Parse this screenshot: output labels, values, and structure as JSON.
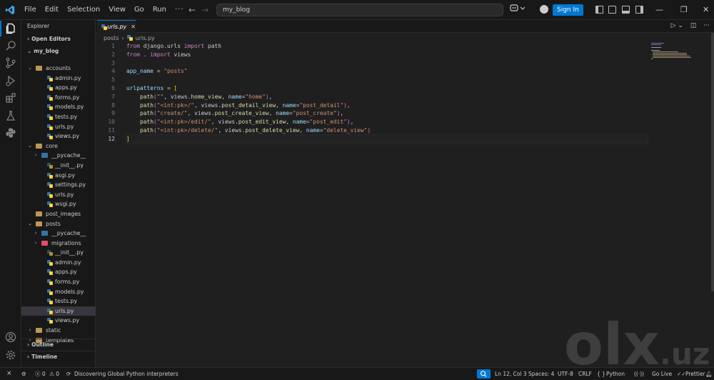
{
  "menu": [
    "File",
    "Edit",
    "Selection",
    "View",
    "Go",
    "Run",
    "···"
  ],
  "nav": {
    "back": "←",
    "forward": "→"
  },
  "command_center": {
    "text": "my_blog"
  },
  "signin_label": "Sign In",
  "sidebar": {
    "title": "Explorer",
    "open_editors": "Open Editors",
    "root": "my_blog",
    "tree": [
      {
        "label": "accounts",
        "type": "folder",
        "depth": 1,
        "open": true
      },
      {
        "label": "admin.py",
        "type": "py",
        "depth": 2
      },
      {
        "label": "apps.py",
        "type": "py",
        "depth": 2
      },
      {
        "label": "forms.py",
        "type": "py",
        "depth": 2
      },
      {
        "label": "models.py",
        "type": "py",
        "depth": 2
      },
      {
        "label": "tests.py",
        "type": "py",
        "depth": 2
      },
      {
        "label": "urls.py",
        "type": "py",
        "depth": 2
      },
      {
        "label": "views.py",
        "type": "py",
        "depth": 2
      },
      {
        "label": "core",
        "type": "folder",
        "depth": 1,
        "open": true
      },
      {
        "label": "__pycache__",
        "type": "pyfolder",
        "depth": 2,
        "open": false
      },
      {
        "label": "__init__.py",
        "type": "pyinit",
        "depth": 2
      },
      {
        "label": "asgi.py",
        "type": "py",
        "depth": 2
      },
      {
        "label": "settings.py",
        "type": "py",
        "depth": 2
      },
      {
        "label": "urls.py",
        "type": "py",
        "depth": 2
      },
      {
        "label": "wsgi.py",
        "type": "py",
        "depth": 2
      },
      {
        "label": "post_images",
        "type": "folder",
        "depth": 1,
        "open": null
      },
      {
        "label": "posts",
        "type": "folder",
        "depth": 1,
        "open": true
      },
      {
        "label": "__pycache__",
        "type": "pyfolder",
        "depth": 2,
        "open": false
      },
      {
        "label": "migrations",
        "type": "migfolder",
        "depth": 2,
        "open": false
      },
      {
        "label": "__init__.py",
        "type": "pyinit",
        "depth": 2
      },
      {
        "label": "admin.py",
        "type": "py",
        "depth": 2
      },
      {
        "label": "apps.py",
        "type": "py",
        "depth": 2
      },
      {
        "label": "forms.py",
        "type": "py",
        "depth": 2
      },
      {
        "label": "models.py",
        "type": "py",
        "depth": 2
      },
      {
        "label": "tests.py",
        "type": "py",
        "depth": 2
      },
      {
        "label": "urls.py",
        "type": "py",
        "depth": 2,
        "selected": true
      },
      {
        "label": "views.py",
        "type": "py",
        "depth": 2
      },
      {
        "label": "static",
        "type": "folder",
        "depth": 1,
        "open": false
      },
      {
        "label": "templates",
        "type": "folder",
        "depth": 1,
        "open": false
      }
    ],
    "outline": "Outline",
    "timeline": "Timeline"
  },
  "editor": {
    "tab_label": "urls.py",
    "breadcrumb": [
      "posts",
      "urls.py"
    ],
    "line_numbers": [
      "1",
      "2",
      "3",
      "4",
      "5",
      "6",
      "7",
      "8",
      "9",
      "10",
      "11",
      "12"
    ],
    "current_line": 12,
    "code": [
      [
        [
          "k",
          "from"
        ],
        [
          "t",
          " django.urls "
        ],
        [
          "k",
          "import"
        ],
        [
          "t",
          " path"
        ]
      ],
      [
        [
          "k",
          "from"
        ],
        [
          "t",
          " . "
        ],
        [
          "k",
          "import"
        ],
        [
          "t",
          " views"
        ]
      ],
      [],
      [
        [
          "v",
          "app_name"
        ],
        [
          "t",
          " = "
        ],
        [
          "s",
          "\"posts\""
        ]
      ],
      [],
      [
        [
          "v",
          "urlpatterns"
        ],
        [
          "t",
          " = "
        ],
        [
          "b",
          "["
        ]
      ],
      [
        [
          "t",
          "    "
        ],
        [
          "f",
          "path"
        ],
        [
          "p",
          "("
        ],
        [
          "s",
          "\"\""
        ],
        [
          "t",
          ", views."
        ],
        [
          "f",
          "home_view"
        ],
        [
          "t",
          ", "
        ],
        [
          "v",
          "name"
        ],
        [
          "t",
          "="
        ],
        [
          "s",
          "\"home\""
        ],
        [
          "p",
          ")"
        ],
        [
          "t",
          ","
        ]
      ],
      [
        [
          "t",
          "    "
        ],
        [
          "f",
          "path"
        ],
        [
          "p",
          "("
        ],
        [
          "s",
          "\"<int:pk>/\""
        ],
        [
          "t",
          ", views."
        ],
        [
          "f",
          "post_detail_view"
        ],
        [
          "t",
          ", "
        ],
        [
          "v",
          "name"
        ],
        [
          "t",
          "="
        ],
        [
          "s",
          "\"post_detail\""
        ],
        [
          "p",
          ")"
        ],
        [
          "t",
          ","
        ]
      ],
      [
        [
          "t",
          "    "
        ],
        [
          "f",
          "path"
        ],
        [
          "p",
          "("
        ],
        [
          "s",
          "\"create/\""
        ],
        [
          "t",
          ", views."
        ],
        [
          "f",
          "post_create_view"
        ],
        [
          "t",
          ", "
        ],
        [
          "v",
          "name"
        ],
        [
          "t",
          "="
        ],
        [
          "s",
          "\"post_create\""
        ],
        [
          "p",
          ")"
        ],
        [
          "t",
          ","
        ]
      ],
      [
        [
          "t",
          "    "
        ],
        [
          "f",
          "path"
        ],
        [
          "p",
          "("
        ],
        [
          "s",
          "\"<int:pk>/edit/\""
        ],
        [
          "t",
          ", views."
        ],
        [
          "f",
          "post_edit_view"
        ],
        [
          "t",
          ", "
        ],
        [
          "v",
          "name"
        ],
        [
          "t",
          "="
        ],
        [
          "s",
          "\"post_edit\""
        ],
        [
          "p",
          ")"
        ],
        [
          "t",
          ","
        ]
      ],
      [
        [
          "t",
          "    "
        ],
        [
          "f",
          "path"
        ],
        [
          "p",
          "("
        ],
        [
          "s",
          "\"<int:pk>/delete/\""
        ],
        [
          "t",
          ", views."
        ],
        [
          "f",
          "post_delete_view"
        ],
        [
          "t",
          ", "
        ],
        [
          "v",
          "name"
        ],
        [
          "t",
          "="
        ],
        [
          "s",
          "\"delete_view\""
        ],
        [
          "p",
          ")"
        ]
      ],
      [
        [
          "b",
          "]"
        ]
      ]
    ]
  },
  "status": {
    "remote": "⨯",
    "errors": "0",
    "warnings": "0",
    "message": "Discovering Global Python interpreters",
    "position": "Ln 12, Col 3",
    "spaces": "Spaces: 4",
    "encoding": "UTF-8",
    "eol": "CRLF",
    "language": "Python",
    "golive": "Go Live",
    "prettier": "Prettier"
  },
  "watermark": {
    "o": "o",
    "l": "l",
    "x": "x",
    "uz": ".uz"
  },
  "colors": {
    "accent": "#0078d4",
    "folder": "#c09553",
    "python_blue": "#3572a5",
    "python_yellow": "#ffd43b",
    "migrations": "#e34c6f"
  }
}
